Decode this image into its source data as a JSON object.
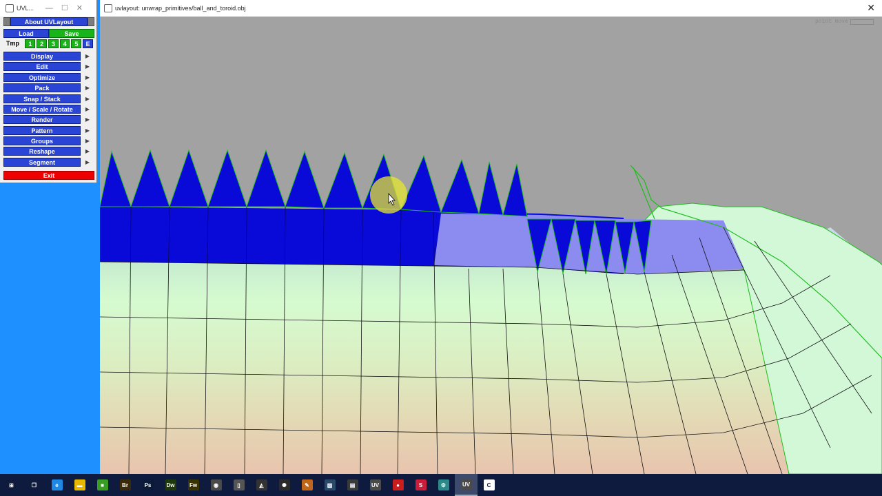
{
  "panel": {
    "title": "UVL...",
    "about_label": "About UVLayout",
    "load_label": "Load",
    "save_label": "Save",
    "tmp_label": "Tmp",
    "slots": [
      "1",
      "2",
      "3",
      "4",
      "5",
      "E"
    ],
    "menu": [
      {
        "label": "Display"
      },
      {
        "label": "Edit"
      },
      {
        "label": "Optimize"
      },
      {
        "label": "Pack"
      },
      {
        "label": "Snap / Stack"
      },
      {
        "label": "Move / Scale / Rotate"
      },
      {
        "label": "Render"
      },
      {
        "label": "Pattern"
      },
      {
        "label": "Groups"
      },
      {
        "label": "Reshape"
      },
      {
        "label": "Segment"
      }
    ],
    "exit_label": "Exit",
    "submenu_arrow": "▶"
  },
  "viewport": {
    "title": "uvlayout: unwrap_primitives/ball_and_toroid.obj",
    "close_glyph": "✕",
    "mode_label": "point move"
  },
  "taskbar": {
    "items": [
      {
        "icon": "windows-start-icon",
        "glyph": "⊞",
        "color": "#0f1a3f"
      },
      {
        "icon": "task-view-icon",
        "glyph": "❐",
        "color": "#0f1a3f"
      },
      {
        "icon": "internet-explorer-icon",
        "glyph": "e",
        "color": "#1e88e5"
      },
      {
        "icon": "file-explorer-icon",
        "glyph": "▬",
        "color": "#e6b800"
      },
      {
        "icon": "green-app-icon",
        "glyph": "■",
        "color": "#3a9d23"
      },
      {
        "icon": "bridge-icon",
        "glyph": "Br",
        "color": "#3b2a0a"
      },
      {
        "icon": "photoshop-icon",
        "glyph": "Ps",
        "color": "#0a1b3a"
      },
      {
        "icon": "dreamweaver-icon",
        "glyph": "Dw",
        "color": "#1f3a0a"
      },
      {
        "icon": "fireworks-icon",
        "glyph": "Fw",
        "color": "#3a3200"
      },
      {
        "icon": "utility-icon",
        "glyph": "◉",
        "color": "#4a4a4a"
      },
      {
        "icon": "terminal-icon",
        "glyph": "▯",
        "color": "#555555"
      },
      {
        "icon": "unity-icon",
        "glyph": "◭",
        "color": "#333333"
      },
      {
        "icon": "network-icon",
        "glyph": "✺",
        "color": "#2b2b2b"
      },
      {
        "icon": "paint-icon",
        "glyph": "✎",
        "color": "#c0661a"
      },
      {
        "icon": "picture-icon",
        "glyph": "▧",
        "color": "#2b4a6b"
      },
      {
        "icon": "film-icon",
        "glyph": "▤",
        "color": "#3a3a3a"
      },
      {
        "icon": "uv-tool-icon",
        "glyph": "UV",
        "color": "#4a4a4a"
      },
      {
        "icon": "red-app-icon",
        "glyph": "●",
        "color": "#c81e1e"
      },
      {
        "icon": "substance-icon",
        "glyph": "S",
        "color": "#c81e3c"
      },
      {
        "icon": "gear-app-icon",
        "glyph": "⚙",
        "color": "#2a8a8a"
      },
      {
        "icon": "uvlayout-icon",
        "glyph": "UV",
        "color": "#4a4a4a",
        "active": true
      },
      {
        "icon": "cinema4d-icon",
        "glyph": "C",
        "color": "#ffffff",
        "fg": "#0f1a3f"
      }
    ]
  },
  "colors": {
    "selected_faces": "#0a0ad8",
    "transition_faces": "#8c8cf0",
    "seam_edge": "#1cbe1c",
    "cursor_highlight": "#e6e632"
  }
}
